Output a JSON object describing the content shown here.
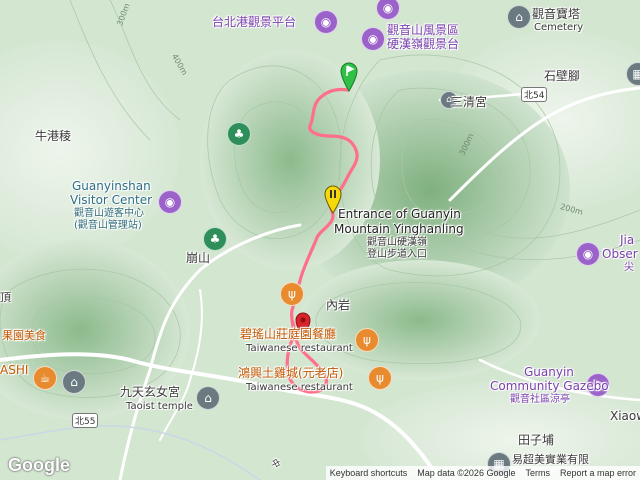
{
  "map": {
    "colors": {
      "terrain_high": "#b9d6b5",
      "terrain_low": "#e4efe1",
      "river": "#bcd7ef",
      "road": "#ffffff",
      "route": "#ff6e8a",
      "start_flag": "#30c046"
    },
    "labels": {
      "taipei_port_platform": "台北港觀景平台",
      "guanyin_scenic_1": "觀音山風景區",
      "guanyin_scenic_2": "硬漢嶺觀景台",
      "guanyin_pagoda": "觀音寶塔",
      "cemetery": "Cemetery",
      "shibijiao": "石壁腳",
      "sanqing_temple": "三清宮",
      "niugangleng": "牛港稜",
      "visitor_center_1": "Guanyinshan",
      "visitor_center_2": "Visitor Center",
      "visitor_center_3": "觀音山遊客中心",
      "visitor_center_4": "(觀音山管理站)",
      "trail_entrance_1": "Entrance of Guanyin",
      "trail_entrance_2": "Mountain Yinghanling",
      "trail_entrance_3": "觀音山硬漢嶺",
      "trail_entrance_4": "登山步道入口",
      "benshan": "崩山",
      "neiyan": "內岩",
      "biyao_restaurant_1": "碧瑤山莊庭園餐廳",
      "biyao_restaurant_2": "Taiwanese restaurant",
      "hongxing_restaurant_1": "鴻興土雞城(元老店)",
      "hongxing_restaurant_2": "Taiwanese restaurant",
      "jiutian_1": "九天玄女宮",
      "jiutian_2": "Taoist temple",
      "left_fruit": "果園美食",
      "left_shi": "ASHI",
      "left_ding": "頂",
      "jia_1": "Jia",
      "jia_2": "Obser",
      "jia_3": "尖",
      "gazebo_1": "Guanyin",
      "gazebo_2": "Community Gazebo",
      "gazebo_3": "觀音社區涼亭",
      "xiaow": "Xiaow",
      "tianzipu": "田子埔",
      "yichao": "易超美實業有限",
      "bei54": "北54",
      "bei55": "北55",
      "zhong": "中"
    },
    "contours": {
      "c300": "300m",
      "c400": "400m",
      "c200": "200m"
    },
    "attribution": {
      "keyboard": "Keyboard shortcuts",
      "mapdata": "Map data ©2026 Google",
      "terms": "Terms",
      "report": "Report a map error"
    },
    "logo": "Google"
  }
}
